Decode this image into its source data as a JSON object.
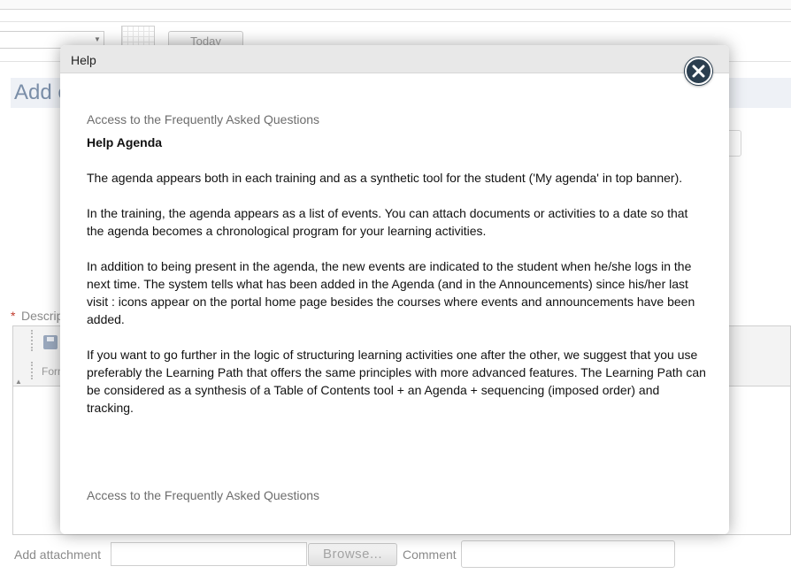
{
  "background": {
    "toolbar": {
      "today_label": "Today"
    },
    "heading": "Add e",
    "description": {
      "required_marker": "*",
      "label": "Descrip"
    },
    "editor": {
      "format_label": "Form"
    },
    "attachment": {
      "label": "Add attachment",
      "browse_label": "Browse...",
      "comment_label": "Comment"
    }
  },
  "modal": {
    "title": "Help",
    "faq_link_top": "Access to the Frequently Asked Questions",
    "help_heading": "Help Agenda",
    "paragraphs": [
      "The agenda appears both in each training and as a synthetic tool for the student ('My agenda' in top banner).",
      "In the training, the agenda appears as a list of events. You can attach documents or activities to a date so that the agenda becomes a chronological program for your learning activities.",
      "In addition to being present in the agenda, the new events are indicated to the student when he/she logs in the next time. The system tells what has been added in the Agenda (and in the Announcements) since his/her last visit : icons appear on the portal home page besides the courses where events and announcements have been added.",
      "If you want to go further in the logic of structuring learning activities one after the other, we suggest that you use preferably the Learning Path that offers the same principles with more advanced features. The Learning Path can be considered as a synthesis of a Table of Contents tool + an Agenda + sequencing (imposed order) and tracking."
    ],
    "faq_link_bottom": "Access to the Frequently Asked Questions",
    "close_icon": "close-icon"
  }
}
